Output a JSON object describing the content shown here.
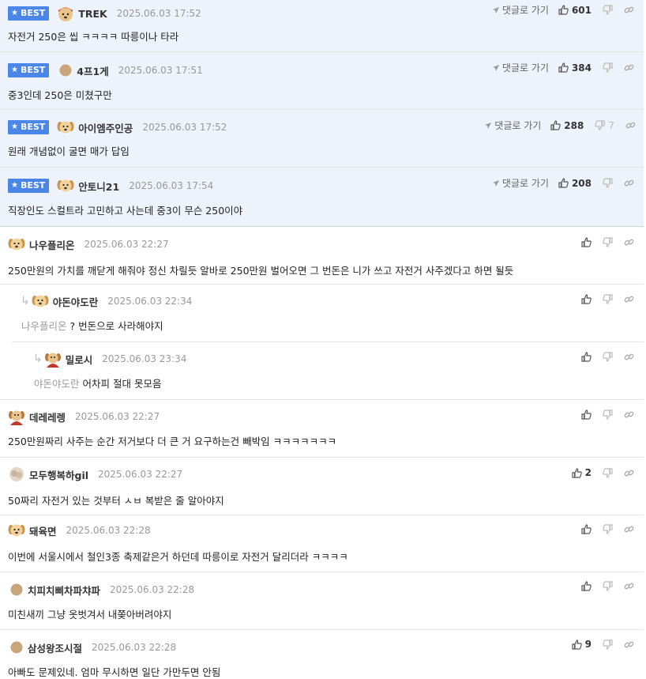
{
  "labels": {
    "best_badge": "BEST",
    "goto_comment": "댓글로 가기"
  },
  "best_comments": [
    {
      "nick": "TREK",
      "date": "2025.06.03 17:52",
      "text": "자전거 250은 씹 ㅋㅋㅋㅋ 따릉이나 타라",
      "likes": "601",
      "dislikes": ""
    },
    {
      "nick": "4프1게",
      "date": "2025.06.03 17:51",
      "text": "중3인데 250은 미쳤구만",
      "likes": "384",
      "dislikes": ""
    },
    {
      "nick": "아이엠주인공",
      "date": "2025.06.03 17:52",
      "text": "원래 개념없이 굴면 매가 답임",
      "likes": "288",
      "dislikes": "7"
    },
    {
      "nick": "안토니21",
      "date": "2025.06.03 17:54",
      "text": "직장인도 스컬트라 고민하고 사는데 중3이 무슨 250이야",
      "likes": "208",
      "dislikes": ""
    }
  ],
  "comments": [
    {
      "nick": "나우플리온",
      "date": "2025.06.03 22:27",
      "text": "250만원의 가치를 깨닫게 해줘야 정신 차릴듯 알바로 250만원 벌어오면 그 번돈은 니가 쓰고 자전거 사주겠다고 하면 될듯",
      "likes": ""
    },
    {
      "nick": "야돈야도란",
      "date": "2025.06.03 22:34",
      "mention": "나우플리온",
      "text": "? 번돈으로 사라해야지",
      "likes": ""
    },
    {
      "nick": "밀로시",
      "date": "2025.06.03 23:34",
      "mention": "야돈야도란",
      "text": "어차피 절대 못모음",
      "likes": ""
    },
    {
      "nick": "데레레렝",
      "date": "2025.06.03 22:27",
      "text": "250만원짜리 사주는 순간 저거보다 더 큰 거 요구하는건 빼박임 ㅋㅋㅋㅋㅋㅋㅋ",
      "likes": ""
    },
    {
      "nick": "모두행복하gil",
      "date": "2025.06.03 22:27",
      "text": "50짜리 자전거 있는 것부터 ㅅㅂ 복받은 줄 알아야지",
      "likes": "2"
    },
    {
      "nick": "돼육면",
      "date": "2025.06.03 22:28",
      "text": "이번에 서울시에서 철인3종 축제같은거 하던데 따릉이로 자전거 달리더라 ㅋㅋㅋㅋ",
      "likes": ""
    },
    {
      "nick": "치피치삐차파챠파",
      "date": "2025.06.03 22:28",
      "text": "미친새끼 그냥 옷벗겨서 내쫒아버려야지",
      "likes": ""
    },
    {
      "nick": "삼성왕조시절",
      "date": "2025.06.03 22:28",
      "text": "아빠도 문제있네. 엄마 무시하면 일단 가만두면 안됨",
      "likes": "9"
    }
  ]
}
